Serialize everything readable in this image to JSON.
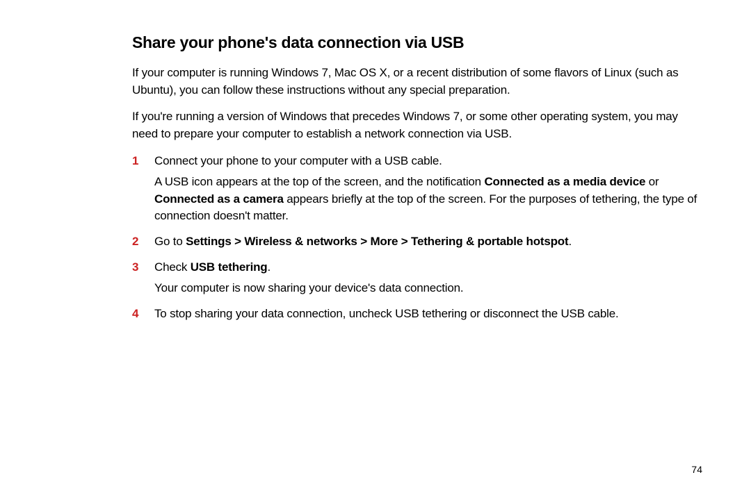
{
  "heading": "Share your phone's data connection via USB",
  "intro": {
    "p1": "If your computer is running Windows 7, Mac OS X, or a recent distribution of some flavors of Linux (such as Ubuntu), you can follow these instructions without any special preparation.",
    "p2": "If you're running a version of Windows that precedes Windows 7, or some other operating system, you may need to prepare your computer to establish a network connection via USB."
  },
  "steps": {
    "s1": {
      "num": "1",
      "line1": "Connect your phone to your computer with a USB cable.",
      "line2a": "A USB icon appears at the top of the screen, and the notification ",
      "line2b": "Connected as a media device",
      "line2c": " or ",
      "line2d": "Connected as a camera",
      "line2e": " appears briefly at the top of the screen. For the purposes of tethering, the type of connection doesn't matter."
    },
    "s2": {
      "num": "2",
      "a": "Go to ",
      "b": "Settings > Wireless & networks > More > Tethering & portable hotspot",
      "c": "."
    },
    "s3": {
      "num": "3",
      "a": "Check ",
      "b": "USB tethering",
      "c": ".",
      "sub": "Your computer is now sharing your device's data connection."
    },
    "s4": {
      "num": "4",
      "text": "To stop sharing your data connection, uncheck USB tethering or disconnect the USB cable."
    }
  },
  "pageNumber": "74"
}
